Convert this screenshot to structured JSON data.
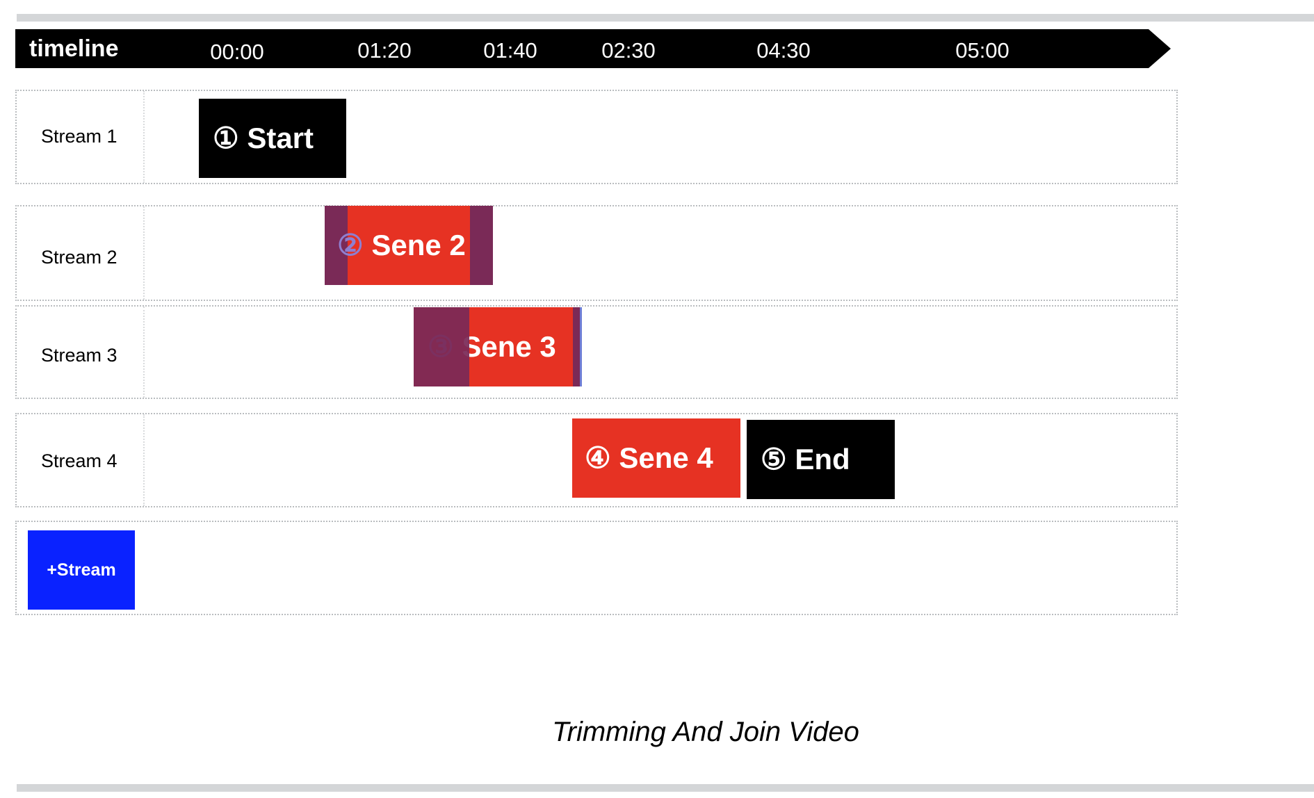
{
  "timeline": {
    "label": "timeline",
    "ticks": [
      "00:00",
      "01:20",
      "01:40",
      "02:30",
      "04:30",
      "05:00"
    ]
  },
  "streams": [
    {
      "label": "Stream 1"
    },
    {
      "label": "Stream 2"
    },
    {
      "label": "Stream 3"
    },
    {
      "label": "Stream 4"
    }
  ],
  "clips": [
    {
      "number": "①",
      "title": "Start",
      "stream": "Stream 1",
      "color": "#000000"
    },
    {
      "number": "②",
      "title": "Sene 2",
      "stream": "Stream 2",
      "color": "#e63223"
    },
    {
      "number": "③",
      "title": "Sene 3",
      "stream": "Stream 3",
      "color": "#e63223"
    },
    {
      "number": "④",
      "title": "Sene 4",
      "stream": "Stream 4",
      "color": "#e63223"
    },
    {
      "number": "⑤",
      "title": "End",
      "stream": "Stream 4",
      "color": "#000000"
    }
  ],
  "colors": {
    "trim_overlay": "#7a2a57",
    "add_stream": "#0a22ff",
    "rule": "#d4d6d8"
  },
  "add_stream_button": {
    "label": "+Stream"
  },
  "caption": "Trimming And Join Video"
}
